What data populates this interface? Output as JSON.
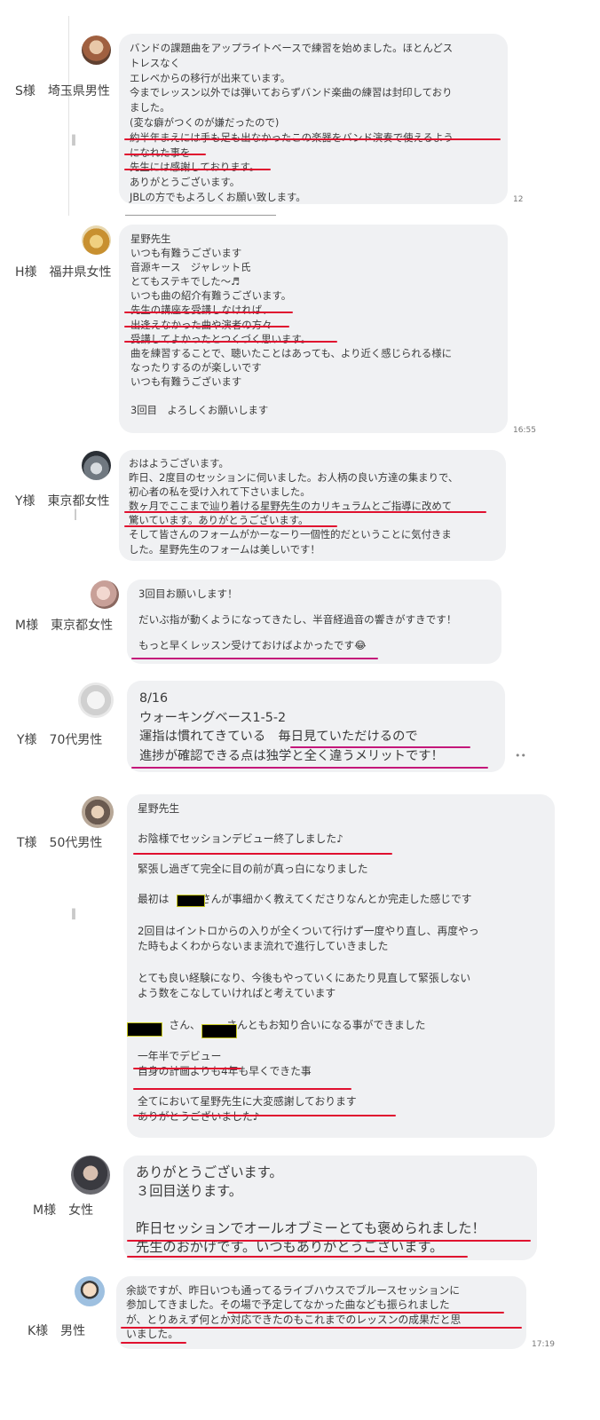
{
  "testimonials": [
    {
      "user": "S様　埼玉県男性",
      "lines": [
        "バンドの課題曲をアップライトベースで練習を始めました。ほとんどス",
        "トレスなく",
        "エレベからの移行が出来ています。",
        "今までレッスン以外では弾いておらずバンド楽曲の練習は封印しており",
        "ました。",
        "(変な癖がつくのが嫌だったので)",
        "約半年まえには手も足も出なかったこの楽器をバンド演奏で使えるよう",
        "になれた事を",
        "先生には感謝しております。",
        "ありがとうございます。",
        "JBLの方でもよろしくお願い致します。"
      ],
      "time": "12"
    },
    {
      "user": "H様　福井県女性",
      "lines": [
        "星野先生",
        "いつも有難うございます",
        "音源キース　ジャレット氏",
        "とてもステキでした〜♬",
        "いつも曲の紹介有難うございます。",
        "先生の講座を受講しなければ、",
        "出逢えなかった曲や演者の方々",
        "受講してよかったとつくづく思います。",
        "曲を練習することで、聴いたことはあっても、より近く感じられる様に",
        "なったりするのが楽しいです",
        "いつも有難うございます",
        "",
        "3回目　よろしくお願いします"
      ],
      "time": "16:55"
    },
    {
      "user": "Y様　東京都女性",
      "lines": [
        "おはようございます。",
        "昨日、2度目のセッションに伺いました。お人柄の良い方達の集まりで、",
        "初心者の私を受け入れて下さいました。",
        "数ヶ月でここまで辿り着ける星野先生のカリキュラムとご指導に改めて",
        "驚いています。ありがとうございます。",
        "そして皆さんのフォームがかーなーり一個性的だということに気付きま",
        "した。星野先生のフォームは美しいです！"
      ]
    },
    {
      "user": "M様　東京都女性",
      "lines": [
        "3回目お願いします！",
        "だいぶ指が動くようになってきたし、半音経過音の響きがすきです！",
        "もっと早くレッスン受けておけばよかったです😂"
      ]
    },
    {
      "user": "Y様　70代男性",
      "lines": [
        "8/16",
        "ウォーキングベース1-5-2",
        "運指は慣れてきている　毎日見ていただけるので",
        "進捗が確認できる点は独学と全く違うメリットです！"
      ]
    },
    {
      "user": "T様　50代男性",
      "lines": [
        "星野先生",
        "お陰様でセッションデビュー終了しました♪",
        "緊張し過ぎて完全に目の前が真っ白になりました",
        "最初は　　　さんが事細かく教えてくださりなんとか完走した感じです",
        "2回目はイントロからの入りが全くついて行けず一度やり直し、再度やっ",
        "た時もよくわからないまま流れで進行していきました",
        "とても良い経験になり、今後もやっていくにあたり見直して緊張しない",
        "よう数をこなしていければと考えています",
        "　　　さん、　　　さんともお知り合いになる事ができました",
        "一年半でデビュー",
        "自身の計画よりも4年も早くできた事",
        "全てにおいて星野先生に大変感謝しております",
        "ありがとうございました♪"
      ]
    },
    {
      "user": "M様　女性",
      "lines": [
        "ありがとうございます。",
        "３回目送ります。",
        "昨日セッションでオールオブミーとても褒められました！",
        "先生のおかげです。いつもありがとうございます。"
      ]
    },
    {
      "user": "K様　男性",
      "lines": [
        "余談ですが、昨日いつも通ってるライブハウスでブルースセッションに",
        "参加してきました。その場で予定してなかった曲なども振られました",
        "が、とりあえず何とか対応できたのもこれまでのレッスンの成果だと思",
        "いました。"
      ],
      "time": "17:19"
    }
  ],
  "more_glyph": "••",
  "divider_glyph": "‖",
  "colors": {
    "bubble": "#f0f1f3",
    "underline_red": "#e0102f",
    "underline_magenta": "#c4187a"
  }
}
